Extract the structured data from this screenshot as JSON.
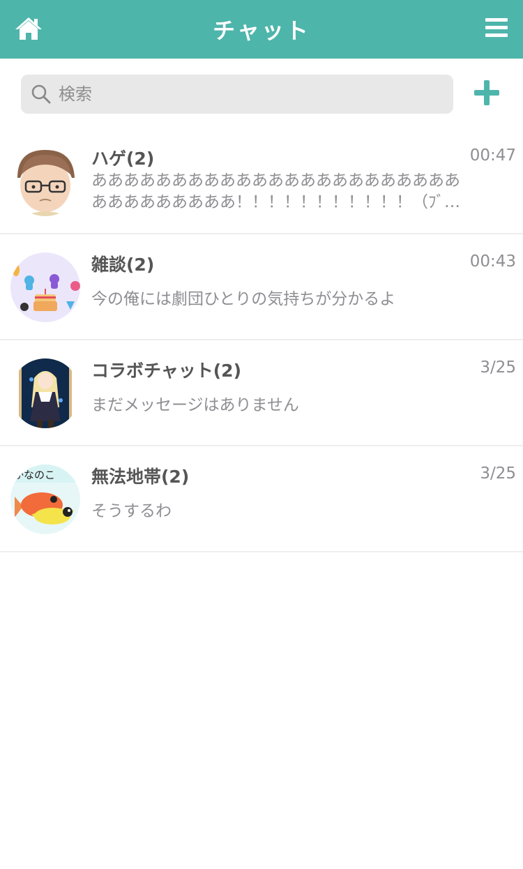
{
  "header": {
    "title": "チャット",
    "home_icon": "home-icon",
    "menu_icon": "hamburger-menu-icon",
    "color": "#4eb5ab"
  },
  "search": {
    "placeholder": "検索",
    "value": "",
    "icon": "search-icon"
  },
  "add_button": {
    "icon": "plus-icon",
    "color": "#4eb5ab"
  },
  "chats": [
    {
      "name": "ハゲ(2)",
      "time": "00:47",
      "message": "ああああああああああああああああああああああああああああああああ！！！！！！！！！！！（ﾌﾞﾘﾌﾞﾘ",
      "avatar": "bald-man-glasses-avatar"
    },
    {
      "name": "雑談(2)",
      "time": "00:43",
      "message": "今の俺には劇団ひとりの気持ちが分かるよ",
      "avatar": "birthday-cake-party-avatar"
    },
    {
      "name": "コラボチャット(2)",
      "time": "3/25",
      "message": "まだメッセージはありません",
      "avatar": "anime-girl-avatar"
    },
    {
      "name": "無法地帯(2)",
      "time": "3/25",
      "message": "そうするわ",
      "avatar": "goldfish-avatar"
    }
  ]
}
